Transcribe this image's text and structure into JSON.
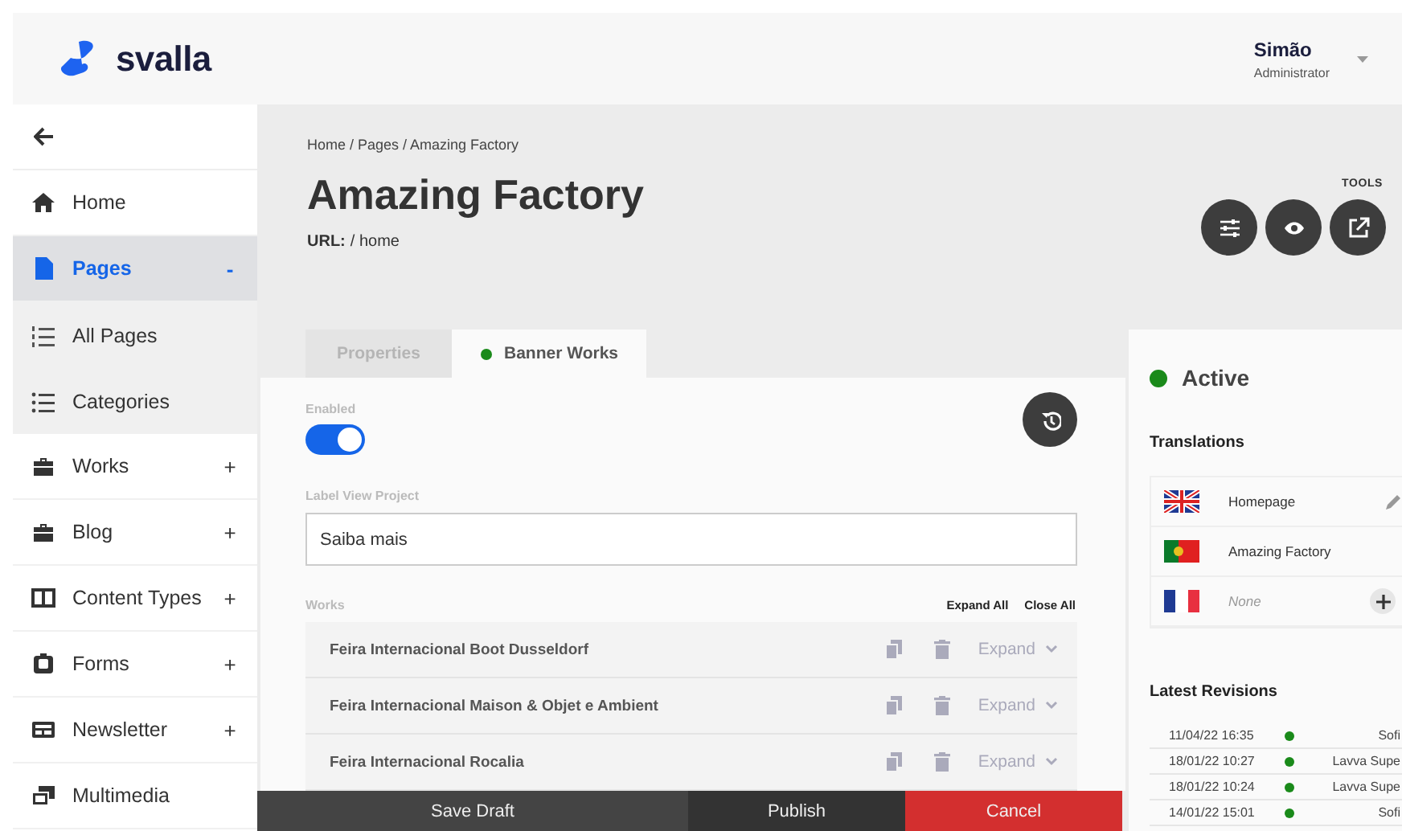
{
  "header": {
    "logo_text": "svalla",
    "user": {
      "name": "Simão",
      "role": "Administrator"
    }
  },
  "sidebar": {
    "items": [
      {
        "label": "Home",
        "selected": false
      },
      {
        "label": "Pages",
        "selected": true,
        "toggle": "-",
        "children": [
          {
            "label": "All Pages",
            "selected": false
          },
          {
            "label": "Categories",
            "selected": false
          }
        ]
      },
      {
        "label": "Works",
        "selected": false,
        "toggle": "+"
      },
      {
        "label": "Blog",
        "selected": false,
        "toggle": "+"
      },
      {
        "label": "Content Types",
        "selected": false,
        "toggle": "+"
      },
      {
        "label": "Forms",
        "selected": false,
        "toggle": "+"
      },
      {
        "label": "Newsletter",
        "selected": false,
        "toggle": "+"
      },
      {
        "label": "Multimedia",
        "selected": false
      }
    ]
  },
  "page": {
    "breadcrumb": "Home / Pages / Amazing Factory",
    "title": "Amazing Factory",
    "url_label": "URL:",
    "url": "/ home",
    "tools_label": "TOOLS"
  },
  "tabs": [
    {
      "label": "Properties",
      "selected": false
    },
    {
      "label": "Banner Works",
      "selected": true,
      "color": "#1a8a1a"
    }
  ],
  "form": {
    "enabled_label": "Enabled",
    "enabled": true,
    "label_view_label": "Label View Project",
    "label_view_value": "Saiba mais",
    "works_label": "Works",
    "expand_all": "Expand All",
    "close_all": "Close All",
    "works": [
      {
        "title": "Feira Internacional Boot Dusseldorf",
        "action": "Expand"
      },
      {
        "title": "Feira Internacional Maison & Objet e Ambient",
        "action": "Expand"
      },
      {
        "title": "Feira Internacional Rocalia",
        "action": "Expand"
      }
    ]
  },
  "footer_buttons": [
    {
      "label": "Save Draft",
      "kind": "draft"
    },
    {
      "label": "Publish",
      "kind": "publish"
    },
    {
      "label": "Cancel",
      "kind": "cancel"
    }
  ],
  "status": {
    "label": "Active",
    "color": "#1a8a1a"
  },
  "translations": {
    "title": "Translations",
    "rows": [
      {
        "kind": "editable",
        "text": "Homepage"
      },
      {
        "kind": "plain",
        "text": "Amazing Factory"
      },
      {
        "kind": "empty",
        "placeholder": "None"
      }
    ]
  },
  "revisions": {
    "title": "Latest Revisions",
    "rows": [
      {
        "date": "11/04/22 16:35",
        "color": "#1a8a1a",
        "author": "Sofi"
      },
      {
        "date": "18/01/22 10:27",
        "color": "#1a8a1a",
        "author": "Lavva Supe"
      },
      {
        "date": "18/01/22 10:24",
        "color": "#1a8a1a",
        "author": "Lavva Supe"
      },
      {
        "date": "14/01/22 15:01",
        "color": "#1a8a1a",
        "author": "Sofi"
      }
    ]
  }
}
